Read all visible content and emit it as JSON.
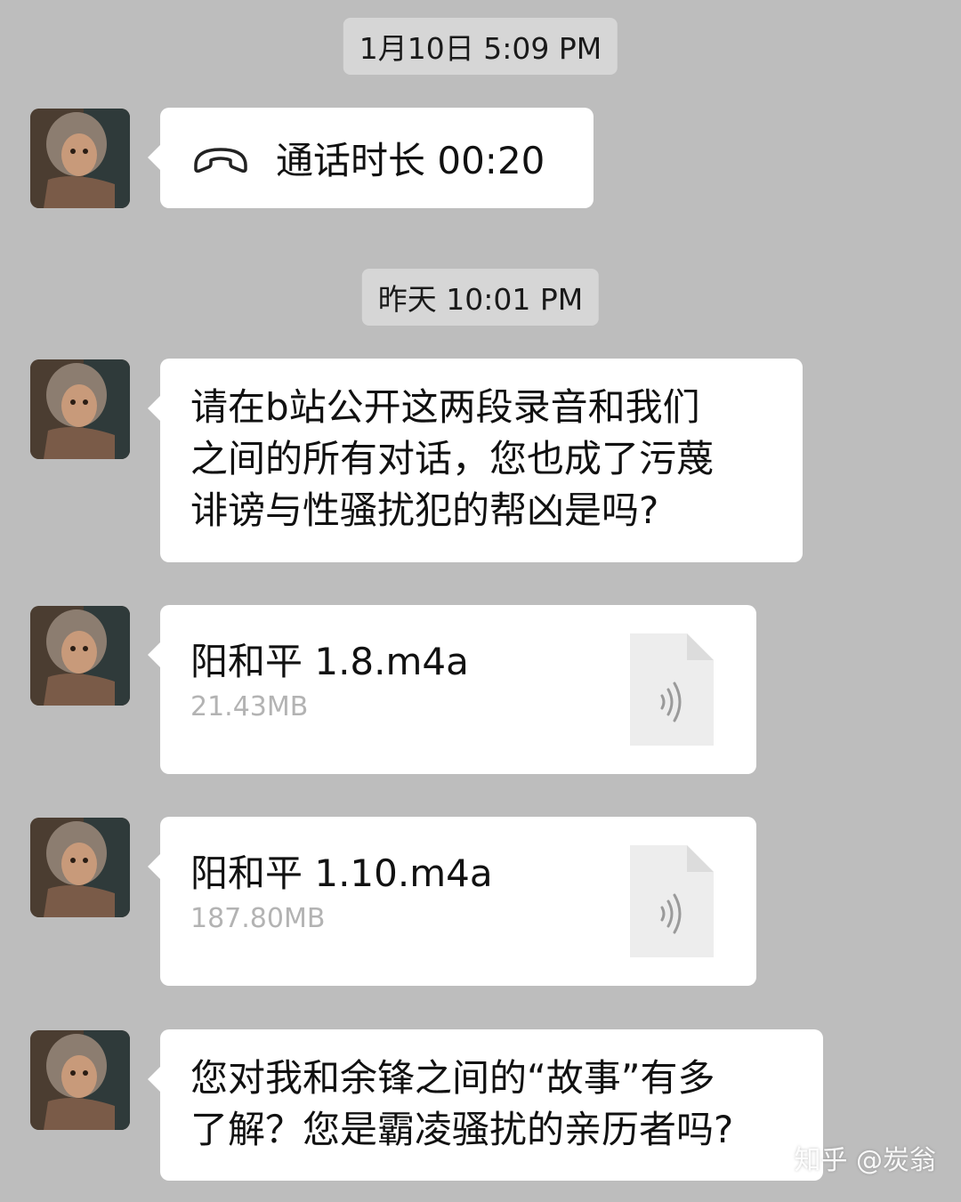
{
  "timestamps": [
    "1月10日 5:09 PM",
    "昨天 10:01 PM"
  ],
  "messages": [
    {
      "type": "call",
      "text": "通话时长 00:20",
      "icon": "phone-hangup-icon"
    },
    {
      "type": "text",
      "text": "请在b站公开这两段录音和我们\n之间的所有对话，您也成了污蔑\n诽谤与性骚扰犯的帮凶是吗?"
    },
    {
      "type": "file",
      "name": "阳和平 1.8.m4a",
      "size": "21.43MB",
      "icon": "audio-file-icon"
    },
    {
      "type": "file",
      "name": "阳和平 1.10.m4a",
      "size": "187.80MB",
      "icon": "audio-file-icon"
    },
    {
      "type": "text",
      "text": "您对我和余锋之间的“故事”有多\n了解？您是霸凌骚扰的亲历者吗?"
    }
  ],
  "watermark": "知乎 @炭翁",
  "colors": {
    "background": "#bdbdbd",
    "bubble": "#ffffff",
    "timestamp_bg": "#d6d6d6",
    "file_size_text": "#b3b3b3"
  }
}
